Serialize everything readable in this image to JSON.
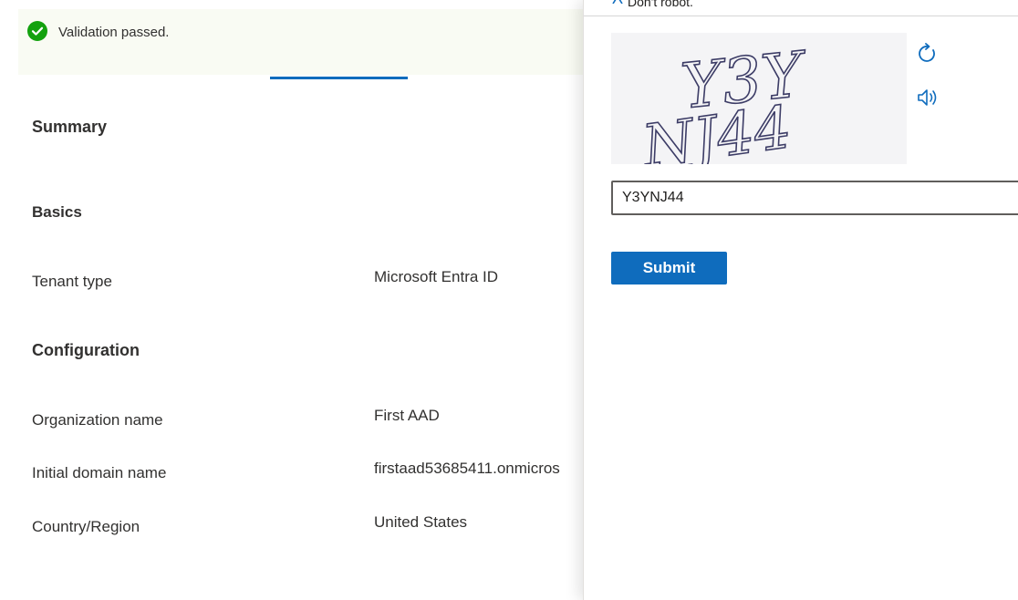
{
  "validation": {
    "message": "Validation passed.",
    "status_color": "#13a10e",
    "icon": "check-circle-icon"
  },
  "summary": {
    "heading": "Summary"
  },
  "basics": {
    "heading": "Basics",
    "rows": [
      {
        "label": "Tenant type",
        "value": "Microsoft Entra ID"
      }
    ]
  },
  "configuration": {
    "heading": "Configuration",
    "rows": [
      {
        "label": "Organization name",
        "value": "First AAD"
      },
      {
        "label": "Initial domain name",
        "value": "firstaad53685411.onmicros"
      },
      {
        "label": "Country/Region",
        "value": "United States"
      }
    ]
  },
  "captcha_panel": {
    "header_partial_text": "Don't robot.",
    "captcha_image_text": [
      "Y3Y",
      "NJ44"
    ],
    "refresh_icon": "refresh-icon",
    "audio_icon": "speaker-icon",
    "input_value": "Y3YNJ44",
    "submit_label": "Submit",
    "accent_color": "#0f6cbd"
  }
}
